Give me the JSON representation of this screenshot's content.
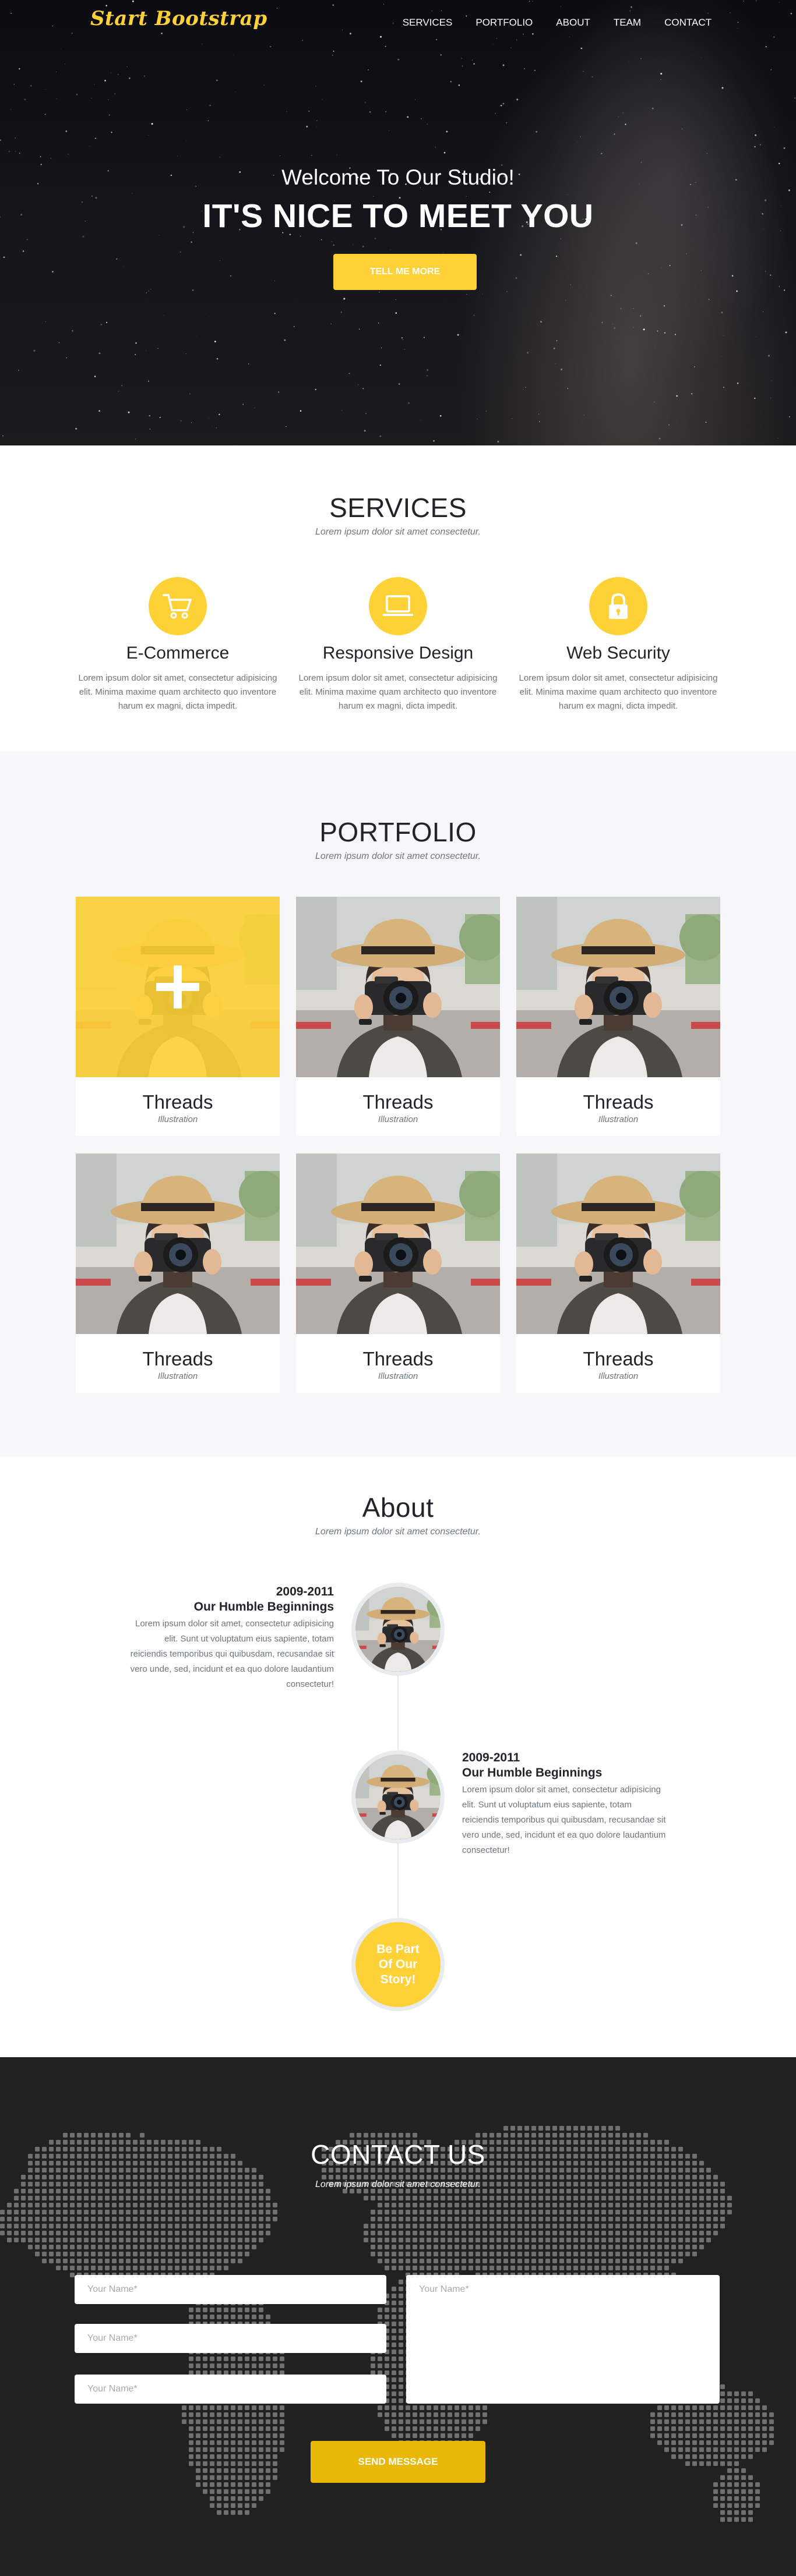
{
  "nav": {
    "brand": "Start Bootstrap",
    "links": [
      "SERVICES",
      "PORTFOLIO",
      "ABOUT",
      "TEAM",
      "CONTACT"
    ]
  },
  "hero": {
    "subheading": "Welcome To Our Studio!",
    "heading": "IT'S NICE TO MEET YOU",
    "button": "TELL ME MORE"
  },
  "services": {
    "heading": "SERVICES",
    "subheading": "Lorem ipsum dolor sit amet consectetur.",
    "items": [
      {
        "icon": "shopping-cart-icon",
        "title": "E-Commerce",
        "text": "Lorem ipsum dolor sit amet, consectetur adipisicing elit. Minima maxime quam architecto quo inventore harum ex magni, dicta impedit."
      },
      {
        "icon": "laptop-icon",
        "title": "Responsive Design",
        "text": "Lorem ipsum dolor sit amet, consectetur adipisicing elit. Minima maxime quam architecto quo inventore harum ex magni, dicta impedit."
      },
      {
        "icon": "lock-icon",
        "title": "Web Security",
        "text": "Lorem ipsum dolor sit amet, consectetur adipisicing elit. Minima maxime quam architecto quo inventore harum ex magni, dicta impedit."
      }
    ]
  },
  "portfolio": {
    "heading": "PORTFOLIO",
    "subheading": "Lorem ipsum dolor sit amet consectetur.",
    "items": [
      {
        "title": "Threads",
        "caption": "Illustration"
      },
      {
        "title": "Threads",
        "caption": "Illustration"
      },
      {
        "title": "Threads",
        "caption": "Illustration"
      },
      {
        "title": "Threads",
        "caption": "Illustration"
      },
      {
        "title": "Threads",
        "caption": "Illustration"
      },
      {
        "title": "Threads",
        "caption": "Illustration"
      }
    ]
  },
  "about": {
    "heading": "About",
    "subheading": "Lorem ipsum dolor sit amet consectetur.",
    "timeline": [
      {
        "year": "2009-2011",
        "title": "Our Humble Beginnings",
        "text": "Lorem ipsum dolor sit amet, consectetur adipisicing elit. Sunt ut voluptatum eius sapiente, totam reiciendis temporibus qui quibusdam, recusandae sit vero unde, sed, incidunt et ea quo dolore laudantium consectetur!"
      },
      {
        "year": "2009-2011",
        "title": "Our Humble Beginnings",
        "text": "Lorem ipsum dolor sit amet, consectetur adipisicing elit. Sunt ut voluptatum eius sapiente, totam reiciendis temporibus qui quibusdam, recusandae sit vero unde, sed, incidunt et ea quo dolore laudantium consectetur!"
      }
    ],
    "final": "Be Part Of Our Story!"
  },
  "contact": {
    "heading": "CONTACT US",
    "subheading": "Lorem ipsum dolor sit amet consectetur.",
    "name_placeholder_1": "Your Name*",
    "name_placeholder_2": "Your Name*",
    "name_placeholder_3": "Your Name*",
    "message_placeholder": "Your Name*",
    "button": "SEND MESSAGE"
  },
  "colors": {
    "accent": "#fed136",
    "dark": "#212121",
    "light_bg": "#f7f7f9"
  }
}
